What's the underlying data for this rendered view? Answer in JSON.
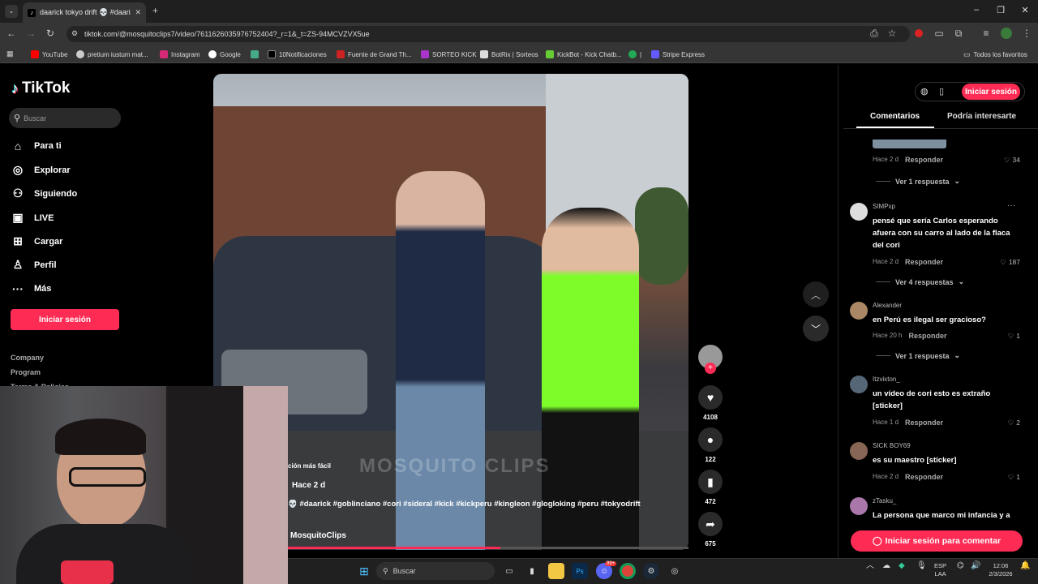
{
  "browser": {
    "tab_title": "daarick tokyo drift 💀 #daarick",
    "url": "tiktok.com/@mosquitoclips7/video/7611626035976752404?_r=1&_t=ZS-94MCVZVX5ue",
    "bookmarks": [
      "YouTube",
      "pretium iustum mat...",
      "Instagram",
      "Google",
      "",
      "10Notificaciones",
      "Fuente de Grand Th...",
      "SORTEO KICK",
      "BotRix | Sorteos",
      "KickBot - Kick Chatb...",
      "|",
      "Stripe Express"
    ],
    "all_bookmarks": "Todos los favoritos"
  },
  "tiktok": {
    "brand": "TikTok",
    "search_placeholder": "Buscar",
    "nav": [
      {
        "label": "Para ti",
        "icon": "home-icon"
      },
      {
        "label": "Explorar",
        "icon": "compass-icon"
      },
      {
        "label": "Siguiendo",
        "icon": "users-icon"
      },
      {
        "label": "LIVE",
        "icon": "live-icon"
      },
      {
        "label": "Cargar",
        "icon": "upload-icon"
      },
      {
        "label": "Perfil",
        "icon": "profile-icon"
      },
      {
        "label": "Más",
        "icon": "more-icon"
      }
    ],
    "login": "Iniciar sesión",
    "footer": [
      "Company",
      "Program",
      "Terms & Policies"
    ]
  },
  "video": {
    "caption_top": "ción más fácil",
    "time": "Hace 2 d",
    "hashtags": "💀 #daarick #goblinciano #cori #sideral #kick #kickperu #kingleon #glogloking #peru #tokyodrift",
    "author": "MosquitoClips",
    "watermark": "MOSQUITO CLIPS",
    "progress": 0.53
  },
  "actions": {
    "likes": "4108",
    "comments": "122",
    "saves": "472",
    "shares": "675"
  },
  "comments_panel": {
    "login": "Iniciar sesión",
    "tabs": [
      "Comentarios",
      "Podría interesarte"
    ],
    "first_meta": {
      "time": "Hace 2 d",
      "reply": "Responder",
      "likes": "34",
      "view": "Ver 1 respuesta"
    },
    "items": [
      {
        "user": "SIMPxp",
        "text": "pensé que sería Carlos esperando afuera con su carro al lado de la flaca del cori",
        "time": "Hace 2 d",
        "reply": "Responder",
        "likes": "187",
        "view": "Ver 4 respuestas"
      },
      {
        "user": "Alexander",
        "text": "en Perú es ilegal ser gracioso?",
        "time": "Hace 20 h",
        "reply": "Responder",
        "likes": "1",
        "view": "Ver 1 respuesta"
      },
      {
        "user": "Itzvixton_",
        "text": "un vídeo de cori esto es extraño [sticker]",
        "time": "Hace 1 d",
        "reply": "Responder",
        "likes": "2"
      },
      {
        "user": "SICK BOY69",
        "text": "es su maestro [sticker]",
        "time": "Hace 2 d",
        "reply": "Responder",
        "likes": "1"
      },
      {
        "user": "zTasku_",
        "text": "La persona que marco mi infancia y a"
      }
    ],
    "comment_login": "Iniciar sesión para comentar"
  },
  "taskbar": {
    "search": "Buscar",
    "lang": "ESP",
    "lang2": "LAA",
    "time": "12:06",
    "date": "2/3/2026",
    "badge": "99+"
  }
}
